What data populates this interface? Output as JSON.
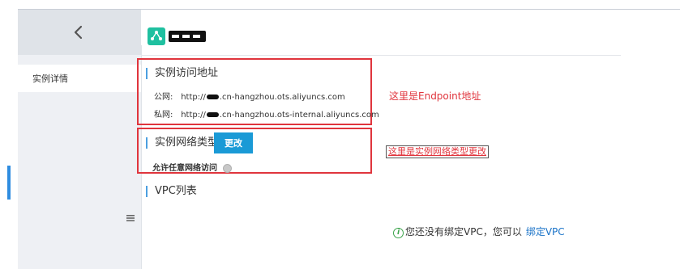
{
  "sidebar": {
    "items": [
      {
        "label": "实例详情"
      }
    ]
  },
  "endpoint_section": {
    "title": "实例访问地址",
    "public": {
      "label": "公网:",
      "prefix": "http://",
      "suffix": ".cn-hangzhou.ots.aliyuncs.com"
    },
    "private": {
      "label": "私网:",
      "prefix": "http://",
      "suffix": ".cn-hangzhou.ots-internal.aliyuncs.com"
    }
  },
  "network_section": {
    "title": "实例网络类型",
    "change_label": "更改",
    "allow_any_label": "允许任意网络访问"
  },
  "vpc_section": {
    "title": "VPC列表",
    "empty_message": "您还没有绑定VPC，您可以",
    "bind_link": "绑定VPC"
  },
  "annotations": {
    "endpoint": "这里是Endpoint地址",
    "network_type": "这里是实例网络类型更改"
  },
  "colors": {
    "accent": "#1a9ad6",
    "annotation_red": "#e0353d",
    "link_blue": "#1a73c8",
    "logo_green": "#1fc0a0"
  }
}
